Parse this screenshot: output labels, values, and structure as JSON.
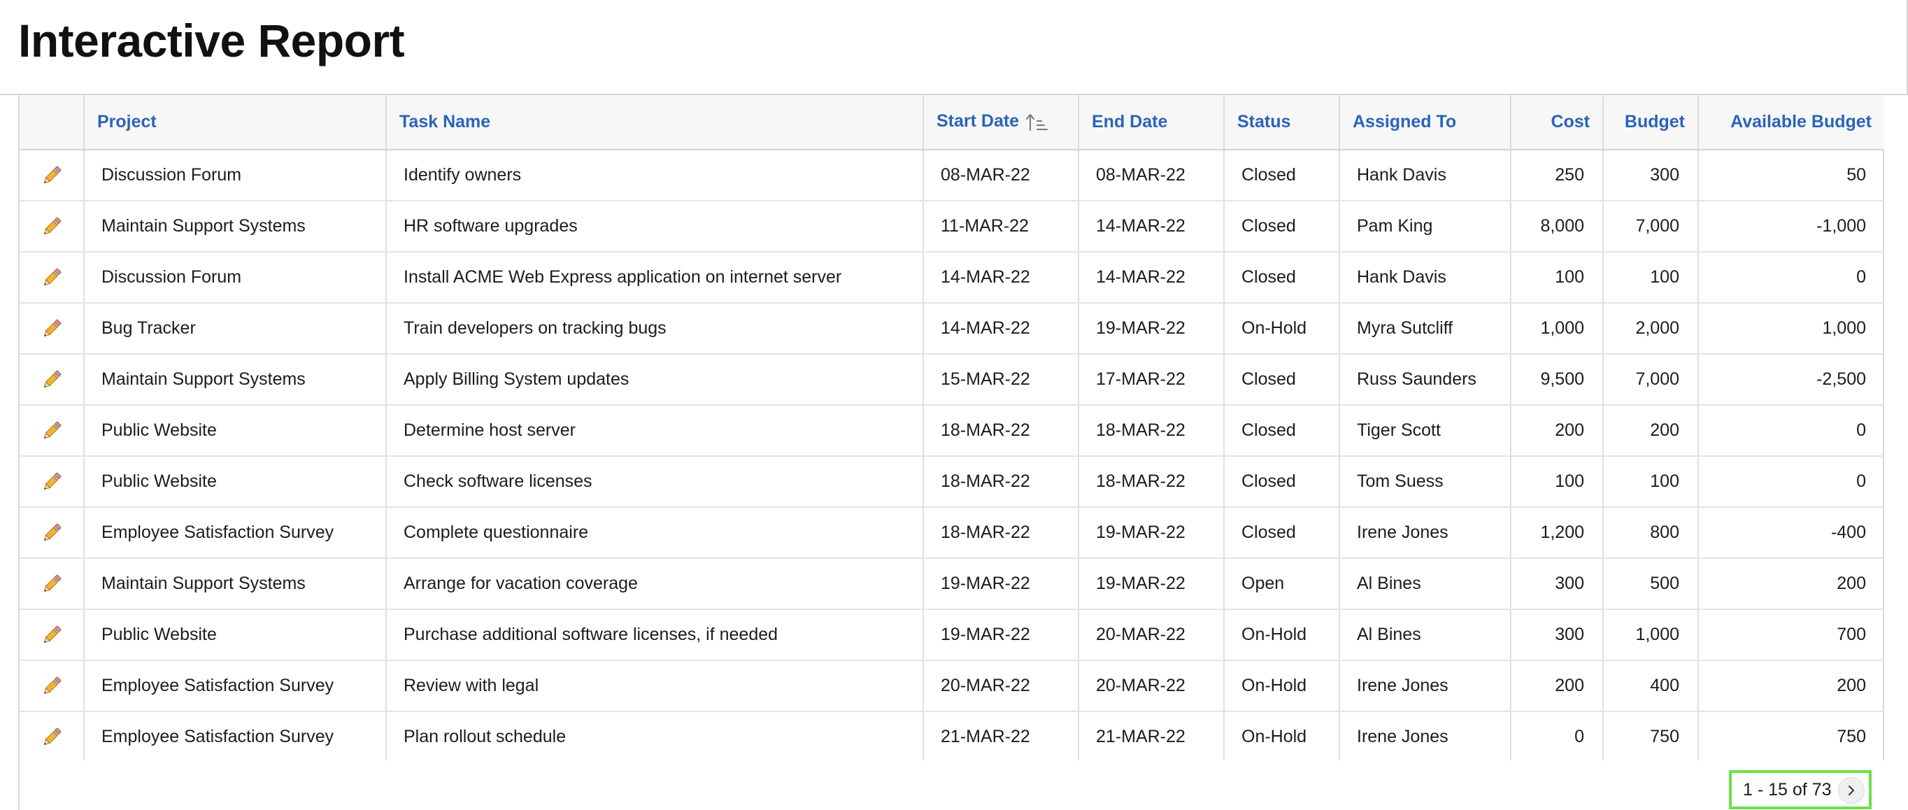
{
  "page": {
    "title": "Interactive Report"
  },
  "report": {
    "columns": [
      {
        "key": "edit",
        "label": ""
      },
      {
        "key": "project",
        "label": "Project"
      },
      {
        "key": "task",
        "label": "Task Name"
      },
      {
        "key": "start",
        "label": "Start Date",
        "sorted": "ascending"
      },
      {
        "key": "end",
        "label": "End Date"
      },
      {
        "key": "status",
        "label": "Status"
      },
      {
        "key": "assigned",
        "label": "Assigned To"
      },
      {
        "key": "cost",
        "label": "Cost"
      },
      {
        "key": "budget",
        "label": "Budget"
      },
      {
        "key": "available",
        "label": "Available Budget"
      }
    ],
    "rows": [
      {
        "project": "Discussion Forum",
        "task": "Identify owners",
        "start": "08-MAR-22",
        "end": "08-MAR-22",
        "status": "Closed",
        "assigned": "Hank Davis",
        "cost": "250",
        "budget": "300",
        "available": "50"
      },
      {
        "project": "Maintain Support Systems",
        "task": "HR software upgrades",
        "start": "11-MAR-22",
        "end": "14-MAR-22",
        "status": "Closed",
        "assigned": "Pam King",
        "cost": "8,000",
        "budget": "7,000",
        "available": "-1,000"
      },
      {
        "project": "Discussion Forum",
        "task": "Install ACME Web Express application on internet server",
        "start": "14-MAR-22",
        "end": "14-MAR-22",
        "status": "Closed",
        "assigned": "Hank Davis",
        "cost": "100",
        "budget": "100",
        "available": "0"
      },
      {
        "project": "Bug Tracker",
        "task": "Train developers on tracking bugs",
        "start": "14-MAR-22",
        "end": "19-MAR-22",
        "status": "On-Hold",
        "assigned": "Myra Sutcliff",
        "cost": "1,000",
        "budget": "2,000",
        "available": "1,000"
      },
      {
        "project": "Maintain Support Systems",
        "task": "Apply Billing System updates",
        "start": "15-MAR-22",
        "end": "17-MAR-22",
        "status": "Closed",
        "assigned": "Russ Saunders",
        "cost": "9,500",
        "budget": "7,000",
        "available": "-2,500"
      },
      {
        "project": "Public Website",
        "task": "Determine host server",
        "start": "18-MAR-22",
        "end": "18-MAR-22",
        "status": "Closed",
        "assigned": "Tiger Scott",
        "cost": "200",
        "budget": "200",
        "available": "0"
      },
      {
        "project": "Public Website",
        "task": "Check software licenses",
        "start": "18-MAR-22",
        "end": "18-MAR-22",
        "status": "Closed",
        "assigned": "Tom Suess",
        "cost": "100",
        "budget": "100",
        "available": "0"
      },
      {
        "project": "Employee Satisfaction Survey",
        "task": "Complete questionnaire",
        "start": "18-MAR-22",
        "end": "19-MAR-22",
        "status": "Closed",
        "assigned": "Irene Jones",
        "cost": "1,200",
        "budget": "800",
        "available": "-400"
      },
      {
        "project": "Maintain Support Systems",
        "task": "Arrange for vacation coverage",
        "start": "19-MAR-22",
        "end": "19-MAR-22",
        "status": "Open",
        "assigned": "Al Bines",
        "cost": "300",
        "budget": "500",
        "available": "200"
      },
      {
        "project": "Public Website",
        "task": "Purchase additional software licenses, if needed",
        "start": "19-MAR-22",
        "end": "20-MAR-22",
        "status": "On-Hold",
        "assigned": "Al Bines",
        "cost": "300",
        "budget": "1,000",
        "available": "700"
      },
      {
        "project": "Employee Satisfaction Survey",
        "task": "Review with legal",
        "start": "20-MAR-22",
        "end": "20-MAR-22",
        "status": "On-Hold",
        "assigned": "Irene Jones",
        "cost": "200",
        "budget": "400",
        "available": "200"
      },
      {
        "project": "Employee Satisfaction Survey",
        "task": "Plan rollout schedule",
        "start": "21-MAR-22",
        "end": "21-MAR-22",
        "status": "On-Hold",
        "assigned": "Irene Jones",
        "cost": "0",
        "budget": "750",
        "available": "750"
      }
    ],
    "pagination": {
      "text": "1 - 15 of 73"
    }
  },
  "icons": {
    "edit": "pencil-icon",
    "sort": "sort-ascending-icon",
    "next": "chevron-right-icon"
  },
  "colors": {
    "header_link": "#2a64b8",
    "header_bg": "#f7f7f7",
    "highlight": "#6ee04a"
  }
}
